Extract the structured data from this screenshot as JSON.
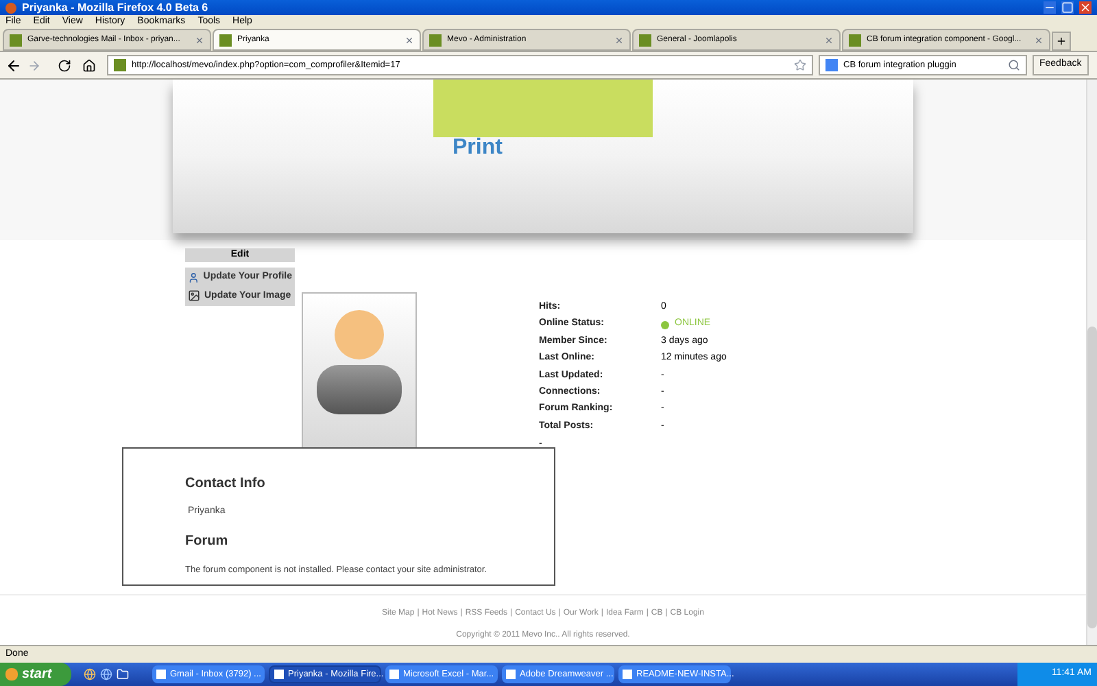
{
  "window": {
    "title": "Priyanka - Mozilla Firefox 4.0 Beta 6"
  },
  "menu": [
    "File",
    "Edit",
    "View",
    "History",
    "Bookmarks",
    "Tools",
    "Help"
  ],
  "tabs": [
    {
      "label": "Garve-technologies Mail - Inbox - priyan...",
      "selected": false
    },
    {
      "label": "Priyanka",
      "selected": true
    },
    {
      "label": "Mevo - Administration",
      "selected": false
    },
    {
      "label": "General - Joomlapolis",
      "selected": false
    },
    {
      "label": "CB forum integration component - Googl...",
      "selected": false
    }
  ],
  "address": {
    "value": "http://localhost/mevo/index.php?option=com_comprofiler&Itemid=17"
  },
  "search": {
    "value": "CB forum integration pluggin"
  },
  "feedback": "Feedback",
  "banner": {
    "print": "Print"
  },
  "edit_menu": {
    "title": "Edit",
    "items": [
      {
        "label": "Update Your Profile",
        "kind": "profile"
      },
      {
        "label": "Update Your Image",
        "kind": "image"
      }
    ]
  },
  "stats": [
    {
      "label": "Hits:",
      "value": "0",
      "kind": "text"
    },
    {
      "label": "Online Status:",
      "value": "ONLINE",
      "kind": "status",
      "color": "#8cc63f"
    },
    {
      "label": "Member Since:",
      "value": "3 days ago",
      "kind": "text"
    },
    {
      "label": "Last Online:",
      "value": "12 minutes ago",
      "kind": "text"
    },
    {
      "label": "Last Updated:",
      "value": "-",
      "kind": "text"
    },
    {
      "label": "Connections:",
      "value": "-",
      "kind": "text"
    },
    {
      "label": "Forum Ranking:",
      "value": "-",
      "kind": "text"
    },
    {
      "label": "Total Posts:",
      "value": "-",
      "kind": "text"
    }
  ],
  "stats_trailer": "-",
  "contact": {
    "heading": "Contact Info",
    "name": "Priyanka",
    "forum_heading": "Forum",
    "forum_message": "The forum component is not installed. Please contact your site administrator."
  },
  "footer": {
    "links": [
      "Site Map",
      "Hot News",
      "RSS Feeds",
      "Contact Us",
      "Our Work",
      "Idea Farm",
      "CB",
      "CB Login"
    ],
    "separator": "|",
    "copyright": "Copyright © 2011 Mevo Inc.. All rights reserved."
  },
  "status_bar": {
    "text": "Done"
  },
  "taskbar": {
    "start": "start",
    "items": [
      {
        "label": "Gmail - Inbox (3792) ...",
        "selected": false
      },
      {
        "label": "Priyanka - Mozilla Fire...",
        "selected": true
      },
      {
        "label": "Microsoft Excel - Mar...",
        "selected": false
      },
      {
        "label": "Adobe Dreamweaver ...",
        "selected": false
      },
      {
        "label": "README-NEW-INSTA...",
        "selected": false
      }
    ],
    "clock": "11:41 AM"
  }
}
